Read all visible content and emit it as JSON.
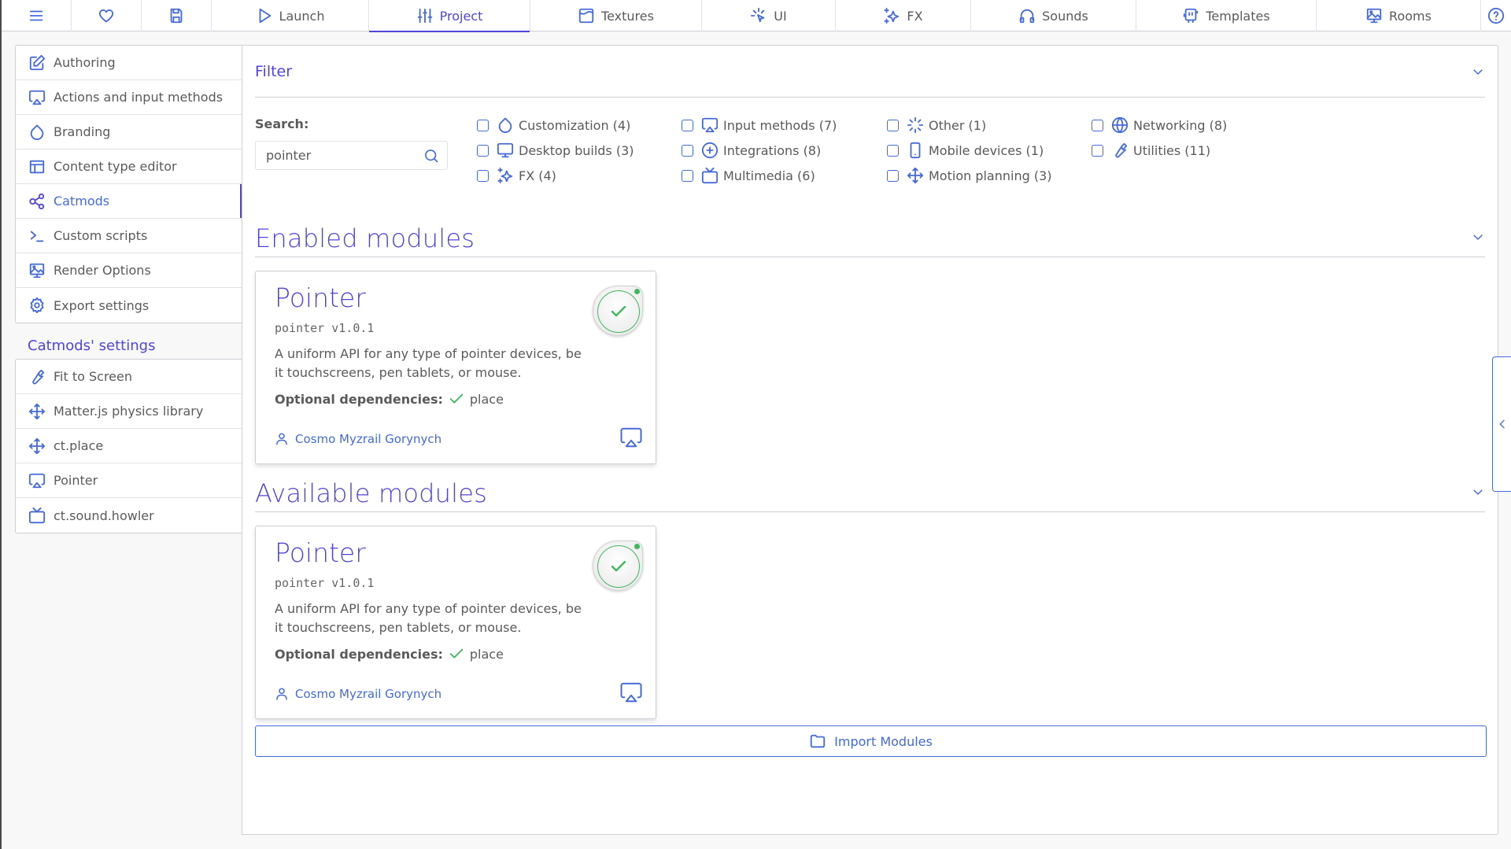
{
  "topnav": {
    "menu_icon": "hamburger-icon",
    "favorite_icon": "heart-icon",
    "save_icon": "floppy-disk-icon",
    "tabs": [
      {
        "label": "Launch",
        "icon": "play-icon"
      },
      {
        "label": "Project",
        "icon": "sliders-icon",
        "active": true
      },
      {
        "label": "Textures",
        "icon": "texture-icon"
      },
      {
        "label": "UI",
        "icon": "pointer-click-icon"
      },
      {
        "label": "FX",
        "icon": "sparkles-icon"
      },
      {
        "label": "Sounds",
        "icon": "headphones-icon"
      },
      {
        "label": "Templates",
        "icon": "template-icon"
      },
      {
        "label": "Rooms",
        "icon": "room-icon"
      }
    ],
    "help_icon": "help-circle-icon"
  },
  "sidebar": {
    "items": [
      {
        "label": "Authoring",
        "icon": "edit-icon"
      },
      {
        "label": "Actions and input methods",
        "icon": "airplay-icon"
      },
      {
        "label": "Branding",
        "icon": "droplet-icon"
      },
      {
        "label": "Content type editor",
        "icon": "table-layout-icon"
      },
      {
        "label": "Catmods",
        "icon": "share-nodes-icon",
        "active": true
      },
      {
        "label": "Custom scripts",
        "icon": "terminal-icon"
      },
      {
        "label": "Render Options",
        "icon": "monitor-image-icon"
      },
      {
        "label": "Export settings",
        "icon": "gear-icon"
      }
    ],
    "settings_heading": "Catmods' settings",
    "settings_items": [
      {
        "label": "Fit to Screen",
        "icon": "wrench-icon"
      },
      {
        "label": "Matter.js physics library",
        "icon": "move-icon"
      },
      {
        "label": "ct.place",
        "icon": "move-icon"
      },
      {
        "label": "Pointer",
        "icon": "airplay-icon"
      },
      {
        "label": "ct.sound.howler",
        "icon": "tv-icon"
      }
    ]
  },
  "filter": {
    "title": "Filter",
    "search_label": "Search:",
    "search_value": "pointer",
    "categories": [
      {
        "label": "Customization (4)",
        "icon": "droplet-icon",
        "checked": false
      },
      {
        "label": "Desktop builds (3)",
        "icon": "monitor-icon",
        "checked": false
      },
      {
        "label": "FX (4)",
        "icon": "sparkles-icon",
        "checked": false
      },
      {
        "label": "Input methods (7)",
        "icon": "airplay-icon",
        "checked": false
      },
      {
        "label": "Integrations (8)",
        "icon": "plus-circle-icon",
        "checked": false
      },
      {
        "label": "Multimedia (6)",
        "icon": "tv-icon",
        "checked": false
      },
      {
        "label": "Other (1)",
        "icon": "loader-icon",
        "checked": false
      },
      {
        "label": "Mobile devices (1)",
        "icon": "smartphone-icon",
        "checked": false
      },
      {
        "label": "Motion planning (3)",
        "icon": "move-icon",
        "checked": false
      },
      {
        "label": "Networking (8)",
        "icon": "globe-icon",
        "checked": false
      },
      {
        "label": "Utilities (11)",
        "icon": "wrench-icon",
        "checked": false
      }
    ]
  },
  "enabled": {
    "title": "Enabled modules",
    "modules": [
      {
        "name": "Pointer",
        "package": "pointer v1.0.1",
        "description": "A uniform API for any type of pointer devices, be it touchscreens, pen tablets, or mouse.",
        "deps_label": "Optional dependencies:",
        "deps": "place",
        "author": "Cosmo Myzrail Gorynych",
        "enabled": true
      }
    ]
  },
  "available": {
    "title": "Available modules",
    "modules": [
      {
        "name": "Pointer",
        "package": "pointer v1.0.1",
        "description": "A uniform API for any type of pointer devices, be it touchscreens, pen tablets, or mouse.",
        "deps_label": "Optional dependencies:",
        "deps": "place",
        "author": "Cosmo Myzrail Gorynych",
        "enabled": true
      }
    ]
  },
  "import_button": "Import Modules",
  "colors": {
    "accent": "#5144db",
    "icon": "#446adb",
    "success": "#41b85a",
    "text": "#5a5a5a",
    "border": "#ccd0d5"
  }
}
